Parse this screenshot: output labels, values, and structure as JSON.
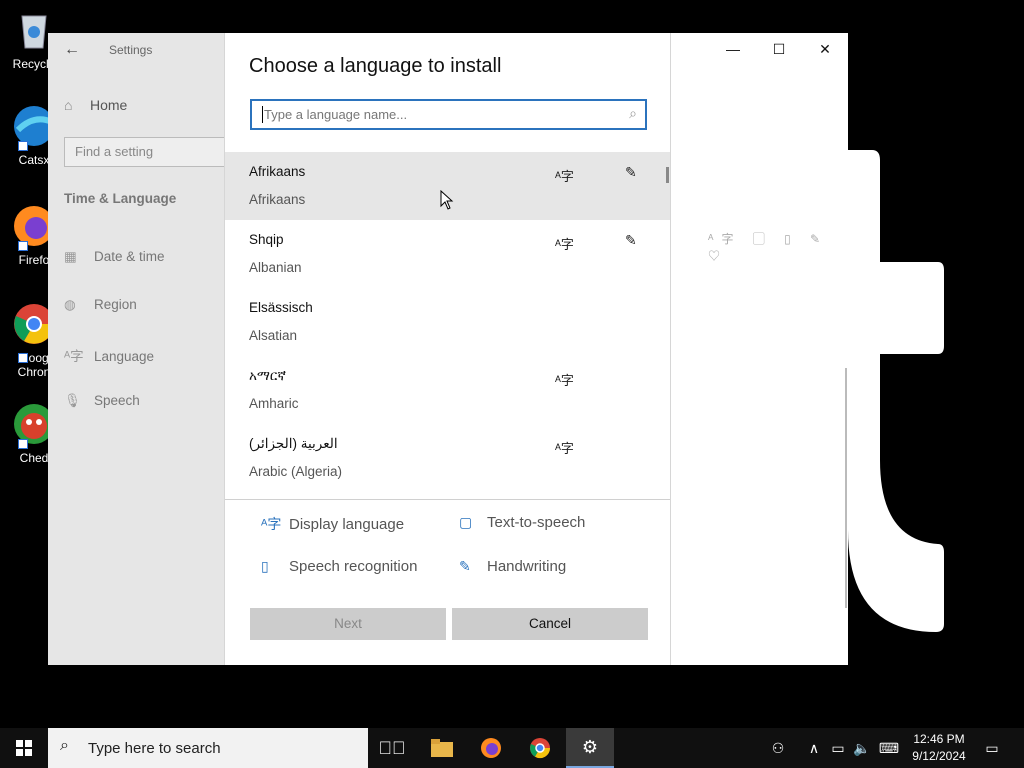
{
  "desktop": {
    "icons": [
      {
        "label": "Recycle",
        "color": "#8ab4d8"
      },
      {
        "label": "Catsx",
        "color": "#2f8fd8"
      },
      {
        "label": "Firefo",
        "color": "#e8622a"
      },
      {
        "label": "Goog Chron",
        "label_line1": "Goog",
        "label_line2": "Chron",
        "color": "#e04a3a"
      },
      {
        "label": "Ched",
        "color": "#d8402c"
      }
    ]
  },
  "settings": {
    "back_icon": "back-arrow-icon",
    "title": "Settings",
    "home": "Home",
    "find_placeholder": "Find a setting",
    "section": "Time & Language",
    "nav": [
      {
        "label": "Date & time",
        "icon": "calendar-icon"
      },
      {
        "label": "Region",
        "icon": "globe-icon"
      },
      {
        "label": "Language",
        "icon": "language-icon"
      },
      {
        "label": "Speech",
        "icon": "microphone-icon"
      }
    ],
    "window_controls": {
      "minimize": "—",
      "maximize": "☐",
      "close": "✕"
    }
  },
  "dialog": {
    "title": "Choose a language to install",
    "search_placeholder": "Type a language name...",
    "languages": [
      {
        "native": "Afrikaans",
        "english": "Afrikaans",
        "display_language": true,
        "handwriting": true,
        "selected": true
      },
      {
        "native": "Shqip",
        "english": "Albanian",
        "display_language": true,
        "handwriting": true,
        "selected": false
      },
      {
        "native": "Elsässisch",
        "english": "Alsatian",
        "display_language": false,
        "handwriting": false,
        "selected": false
      },
      {
        "native": "አማርኛ",
        "english": "Amharic",
        "display_language": true,
        "handwriting": false,
        "selected": false
      },
      {
        "native": "العربية (الجزائر)",
        "english": "Arabic (Algeria)",
        "display_language": true,
        "handwriting": false,
        "selected": false
      }
    ],
    "legend": {
      "display_language": "Display language",
      "text_to_speech": "Text-to-speech",
      "speech_recognition": "Speech recognition",
      "handwriting": "Handwriting"
    },
    "buttons": {
      "next": "Next",
      "cancel": "Cancel"
    }
  },
  "taskbar": {
    "search_placeholder": "Type here to search",
    "time": "12:46 PM",
    "date": "9/12/2024"
  },
  "colors": {
    "accent": "#2b73bd",
    "selected_row": "#e6e6e6",
    "sidebar": "#e6e6e6",
    "taskbar": "#101010"
  }
}
